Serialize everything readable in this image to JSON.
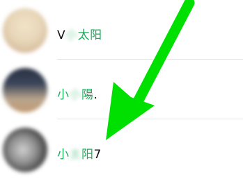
{
  "contacts": [
    {
      "name_parts": [
        {
          "text": "V",
          "style": "dark"
        },
        {
          "text": "小",
          "style": "blur"
        },
        {
          "text": "太阳",
          "style": "green"
        }
      ]
    },
    {
      "name_parts": [
        {
          "text": "小",
          "style": "green"
        },
        {
          "text": "小",
          "style": "blur"
        },
        {
          "text": "陽",
          "style": "green"
        },
        {
          "text": ".",
          "style": "dark"
        }
      ]
    },
    {
      "name_parts": [
        {
          "text": "小",
          "style": "green"
        },
        {
          "text": "太",
          "style": "blur"
        },
        {
          "text": "阳",
          "style": "green"
        },
        {
          "text": "7",
          "style": "dark"
        }
      ]
    }
  ],
  "annotation": {
    "arrow_color": "#00e000",
    "direction": "down-left"
  }
}
